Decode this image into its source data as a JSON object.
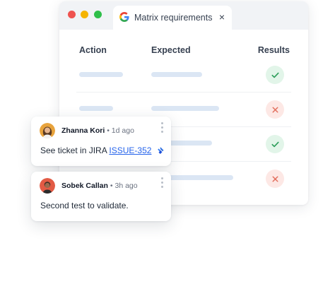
{
  "browser": {
    "tab_title": "Matrix requirements",
    "tab_icon": "google-g-icon",
    "close_icon": "×"
  },
  "table": {
    "headers": {
      "action": "Action",
      "expected": "Expected",
      "results": "Results"
    },
    "rows": [
      {
        "result": "pass",
        "result_icon": "check-icon"
      },
      {
        "result": "fail",
        "result_icon": "x-icon"
      },
      {
        "result": "pass",
        "result_icon": "check-icon"
      },
      {
        "result": "fail",
        "result_icon": "x-icon"
      }
    ]
  },
  "comments": [
    {
      "author": "Zhanna Kori",
      "separator": "•",
      "time": "1d ago",
      "text": "See ticket in JIRA",
      "link": "ISSUE-352",
      "link_icon": "jira-icon"
    },
    {
      "author": "Sobek Callan",
      "separator": "•",
      "time": "3h ago",
      "text": "Second test to validate."
    }
  ],
  "colors": {
    "pass_bg": "#e2f5e9",
    "pass_fg": "#2e9e5b",
    "fail_bg": "#fde8e5",
    "fail_fg": "#e3705f",
    "placeholder_bar": "#dbe6f4",
    "link": "#2563eb"
  }
}
